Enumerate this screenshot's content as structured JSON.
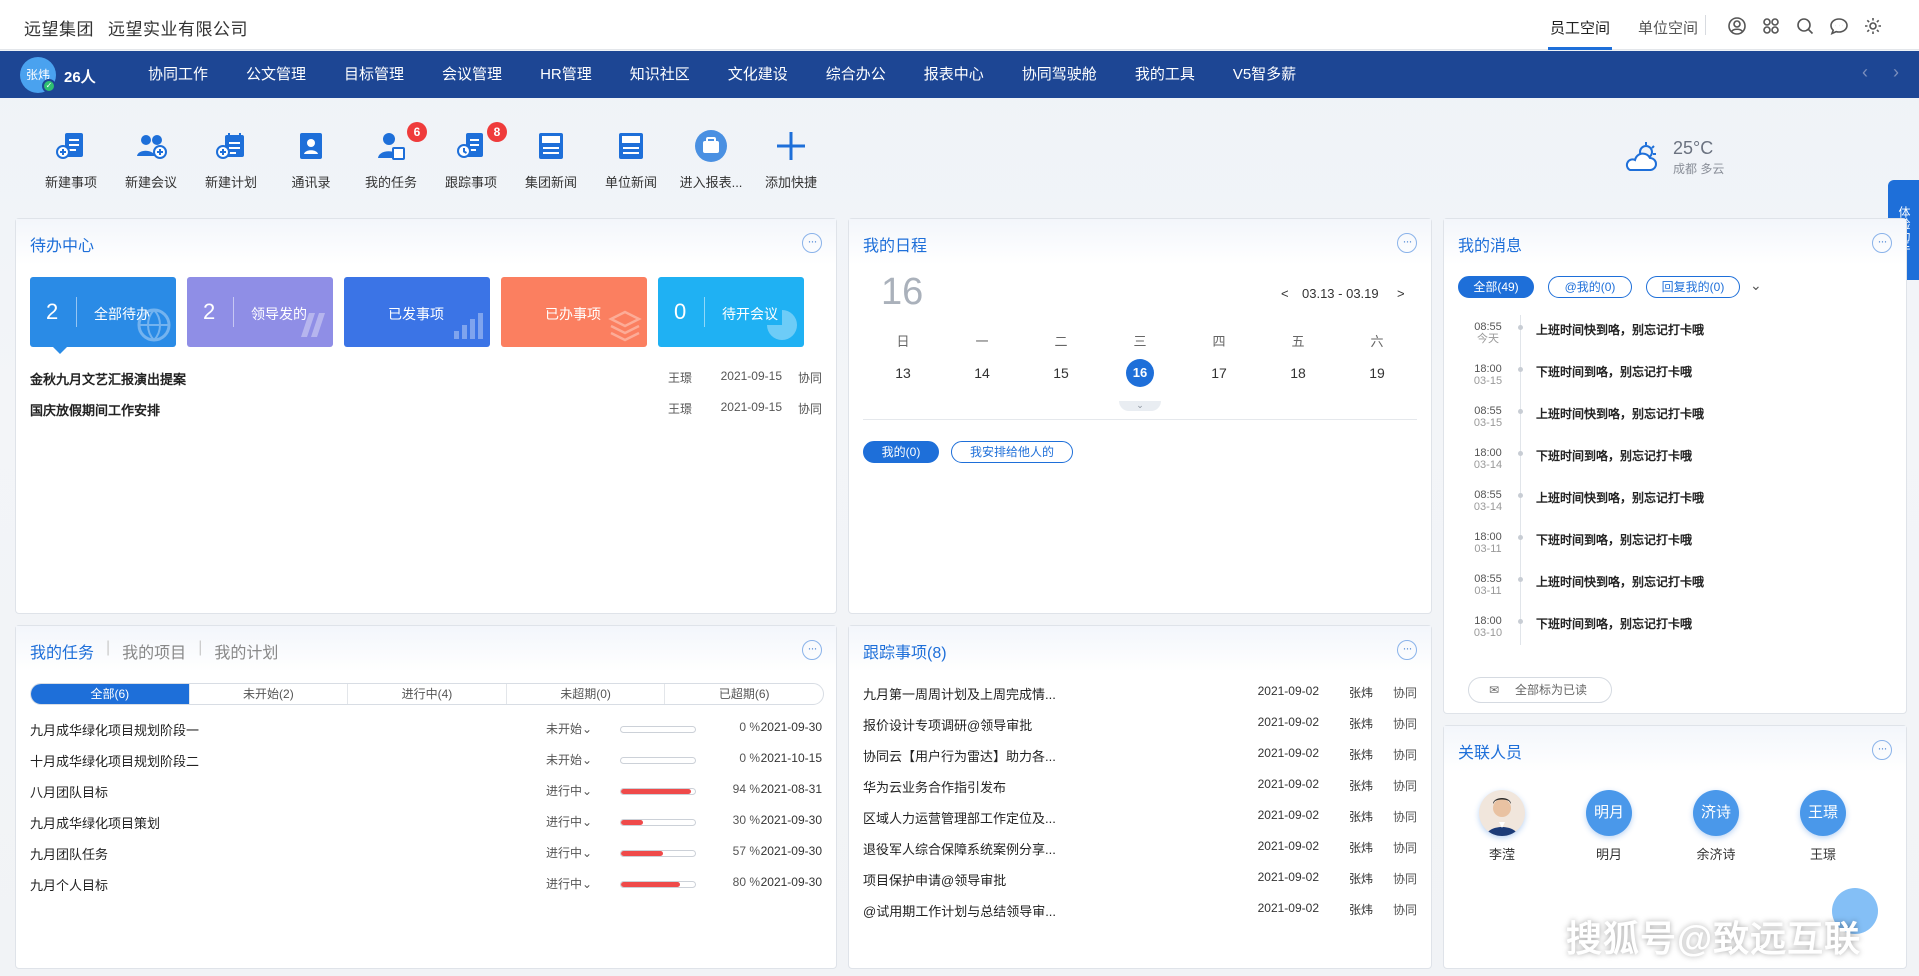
{
  "brand": {
    "group": "远望集团",
    "company": "远望实业有限公司"
  },
  "top_tabs": [
    {
      "label": "员工空间",
      "active": true
    },
    {
      "label": "单位空间",
      "active": false
    }
  ],
  "top_icons": [
    "user-circle-icon",
    "apps-grid-icon",
    "search-icon",
    "chat-icon",
    "gear-icon"
  ],
  "user": {
    "name": "张炜",
    "count": "26人"
  },
  "nav": [
    "协同工作",
    "公文管理",
    "目标管理",
    "会议管理",
    "HR管理",
    "知识社区",
    "文化建设",
    "综合办公",
    "报表中心",
    "协同驾驶舱",
    "我的工具",
    "V5智多薪"
  ],
  "shortcuts": [
    {
      "label": "新建事项",
      "icon": "new-item-icon"
    },
    {
      "label": "新建会议",
      "icon": "new-meeting-icon"
    },
    {
      "label": "新建计划",
      "icon": "new-plan-icon"
    },
    {
      "label": "通讯录",
      "icon": "contacts-icon"
    },
    {
      "label": "我的任务",
      "icon": "my-task-icon",
      "badge": "6"
    },
    {
      "label": "跟踪事项",
      "icon": "track-item-icon",
      "badge": "8"
    },
    {
      "label": "集团新闻",
      "icon": "group-news-icon"
    },
    {
      "label": "单位新闻",
      "icon": "unit-news-icon"
    },
    {
      "label": "进入报表...",
      "icon": "report-icon"
    },
    {
      "label": "添加快捷",
      "icon": "add-shortcut-icon"
    }
  ],
  "weather": {
    "temp": "25°C",
    "location": "成都 多云"
  },
  "helper": {
    "label": "体验助手"
  },
  "todo": {
    "title": "待办中心",
    "cards": [
      {
        "num": "2",
        "label": "全部待办",
        "color": "#2a8be6"
      },
      {
        "num": "2",
        "label": "领导发的",
        "color": "#8f8ee6"
      },
      {
        "num": "",
        "label": "已发事项",
        "color": "#3b74e6"
      },
      {
        "num": "",
        "label": "已办事项",
        "color": "#fb7f60"
      },
      {
        "num": "0",
        "label": "待开会议",
        "color": "#1fb1f3"
      }
    ],
    "rows": [
      {
        "title": "金秋九月文艺汇报演出提案",
        "user": "王璟",
        "date": "2021-09-15",
        "cat": "协同"
      },
      {
        "title": "国庆放假期间工作安排",
        "user": "王璟",
        "date": "2021-09-15",
        "cat": "协同"
      }
    ]
  },
  "schedule": {
    "title": "我的日程",
    "big_day": "16",
    "range": "03.13 - 03.19",
    "prev": "<",
    "next": ">",
    "weekdays": [
      "日",
      "一",
      "二",
      "三",
      "四",
      "五",
      "六"
    ],
    "days": [
      "13",
      "14",
      "15",
      "16",
      "17",
      "18",
      "19"
    ],
    "selected_index": 3,
    "filters": [
      "我的(0)",
      "我安排给他人的"
    ]
  },
  "messages": {
    "title": "我的消息",
    "filters": [
      "全部(49)",
      "@我的(0)",
      "回复我的(0)"
    ],
    "items": [
      {
        "time": "08:55",
        "date": "今天",
        "text": "上班时间快到咯，别忘记打卡哦"
      },
      {
        "time": "18:00",
        "date": "03-15",
        "text": "下班时间到咯，别忘记打卡哦"
      },
      {
        "time": "08:55",
        "date": "03-15",
        "text": "上班时间快到咯，别忘记打卡哦"
      },
      {
        "time": "18:00",
        "date": "03-14",
        "text": "下班时间到咯，别忘记打卡哦"
      },
      {
        "time": "08:55",
        "date": "03-14",
        "text": "上班时间快到咯，别忘记打卡哦"
      },
      {
        "time": "18:00",
        "date": "03-11",
        "text": "下班时间到咯，别忘记打卡哦"
      },
      {
        "time": "08:55",
        "date": "03-11",
        "text": "上班时间快到咯，别忘记打卡哦"
      },
      {
        "time": "18:00",
        "date": "03-10",
        "text": "下班时间到咯，别忘记打卡哦"
      }
    ],
    "mark_all": "全部标为已读"
  },
  "tasks": {
    "tabs": [
      "我的任务",
      "我的项目",
      "我的计划"
    ],
    "filters": [
      "全部(6)",
      "未开始(2)",
      "进行中(4)",
      "未超期(0)",
      "已超期(6)"
    ],
    "rows": [
      {
        "name": "九月成华绿化项目规划阶段一",
        "status": "未开始",
        "progress": 0,
        "pct": "0  %",
        "date": "2021-09-30"
      },
      {
        "name": "十月成华绿化项目规划阶段二",
        "status": "未开始",
        "progress": 0,
        "pct": "0  %",
        "date": "2021-10-15"
      },
      {
        "name": "八月团队目标",
        "status": "进行中",
        "progress": 94,
        "pct": "94  %",
        "date": "2021-08-31"
      },
      {
        "name": "九月成华绿化项目策划",
        "status": "进行中",
        "progress": 30,
        "pct": "30  %",
        "date": "2021-09-30"
      },
      {
        "name": "九月团队任务",
        "status": "进行中",
        "progress": 57,
        "pct": "57  %",
        "date": "2021-09-30"
      },
      {
        "name": "九月个人目标",
        "status": "进行中",
        "progress": 80,
        "pct": "80  %",
        "date": "2021-09-30"
      }
    ]
  },
  "follow": {
    "title": "跟踪事项(8)",
    "rows": [
      {
        "title": "九月第一周周计划及上周完成情...",
        "date": "2021-09-02",
        "user": "张炜",
        "cat": "协同"
      },
      {
        "title": "报价设计专项调研@领导审批",
        "date": "2021-09-02",
        "user": "张炜",
        "cat": "协同"
      },
      {
        "title": "协同云【用户行为雷达】助力各...",
        "date": "2021-09-02",
        "user": "张炜",
        "cat": "协同"
      },
      {
        "title": "华为云业务合作指引发布",
        "date": "2021-09-02",
        "user": "张炜",
        "cat": "协同"
      },
      {
        "title": "区域人力运营管理部工作定位及...",
        "date": "2021-09-02",
        "user": "张炜",
        "cat": "协同"
      },
      {
        "title": "退役军人综合保障系统案例分享...",
        "date": "2021-09-02",
        "user": "张炜",
        "cat": "协同"
      },
      {
        "title": " 项目保护申请@领导审批",
        "date": "2021-09-02",
        "user": "张炜",
        "cat": "协同"
      },
      {
        "title": "@试用期工作计划与总结领导审...",
        "date": "2021-09-02",
        "user": "张炜",
        "cat": "协同"
      }
    ]
  },
  "people": {
    "title": "关联人员",
    "list": [
      {
        "avatar": "",
        "name": "李滢"
      },
      {
        "avatar": "明月",
        "name": "明月"
      },
      {
        "avatar": "济诗",
        "name": "余济诗"
      },
      {
        "avatar": "王璟",
        "name": "王璟"
      }
    ]
  },
  "watermark": "搜狐号@致远互联"
}
